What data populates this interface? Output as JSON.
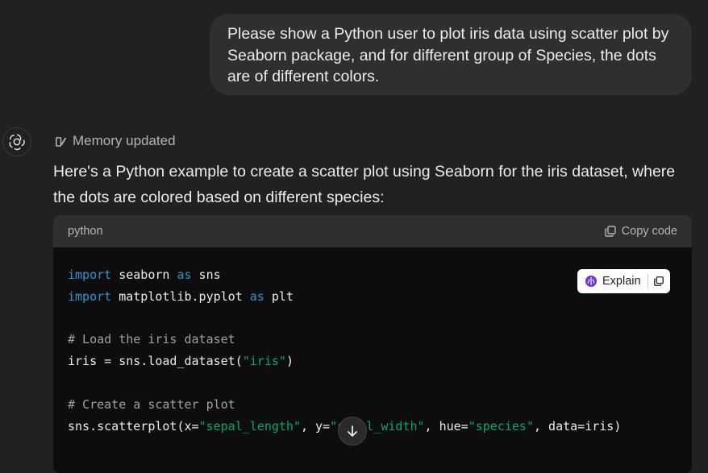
{
  "user_message": "Please show a Python user to plot iris data using scatter plot by Seaborn package, and for different group of Species, the dots are of different colors.",
  "memory_status": "Memory updated",
  "assistant_intro": "Here's a Python example to create a scatter plot using Seaborn for the iris dataset, where the dots are colored based on different species:",
  "code": {
    "language": "python",
    "copy_label": "Copy code",
    "lines": {
      "l1": [
        "import",
        " seaborn ",
        "as",
        " sns"
      ],
      "l2": [
        "import",
        " matplotlib.pyplot ",
        "as",
        " plt"
      ],
      "l4": "# Load the iris dataset",
      "l5": [
        "iris = sns.load_dataset(",
        "\"iris\"",
        ")"
      ],
      "l7": "# Create a scatter plot",
      "l8": [
        "sns.scatterplot(x=",
        "\"sepal_length\"",
        ", y=",
        "\"sepal_width\"",
        ", hue=",
        "\"species\"",
        ", data=iris)"
      ]
    }
  },
  "explain_label": "Explain",
  "icons": {
    "avatar": "openai-logo-icon",
    "memory": "memory-icon",
    "copy": "copy-icon",
    "explain": "brain-icon",
    "scroll": "arrow-down-icon"
  }
}
